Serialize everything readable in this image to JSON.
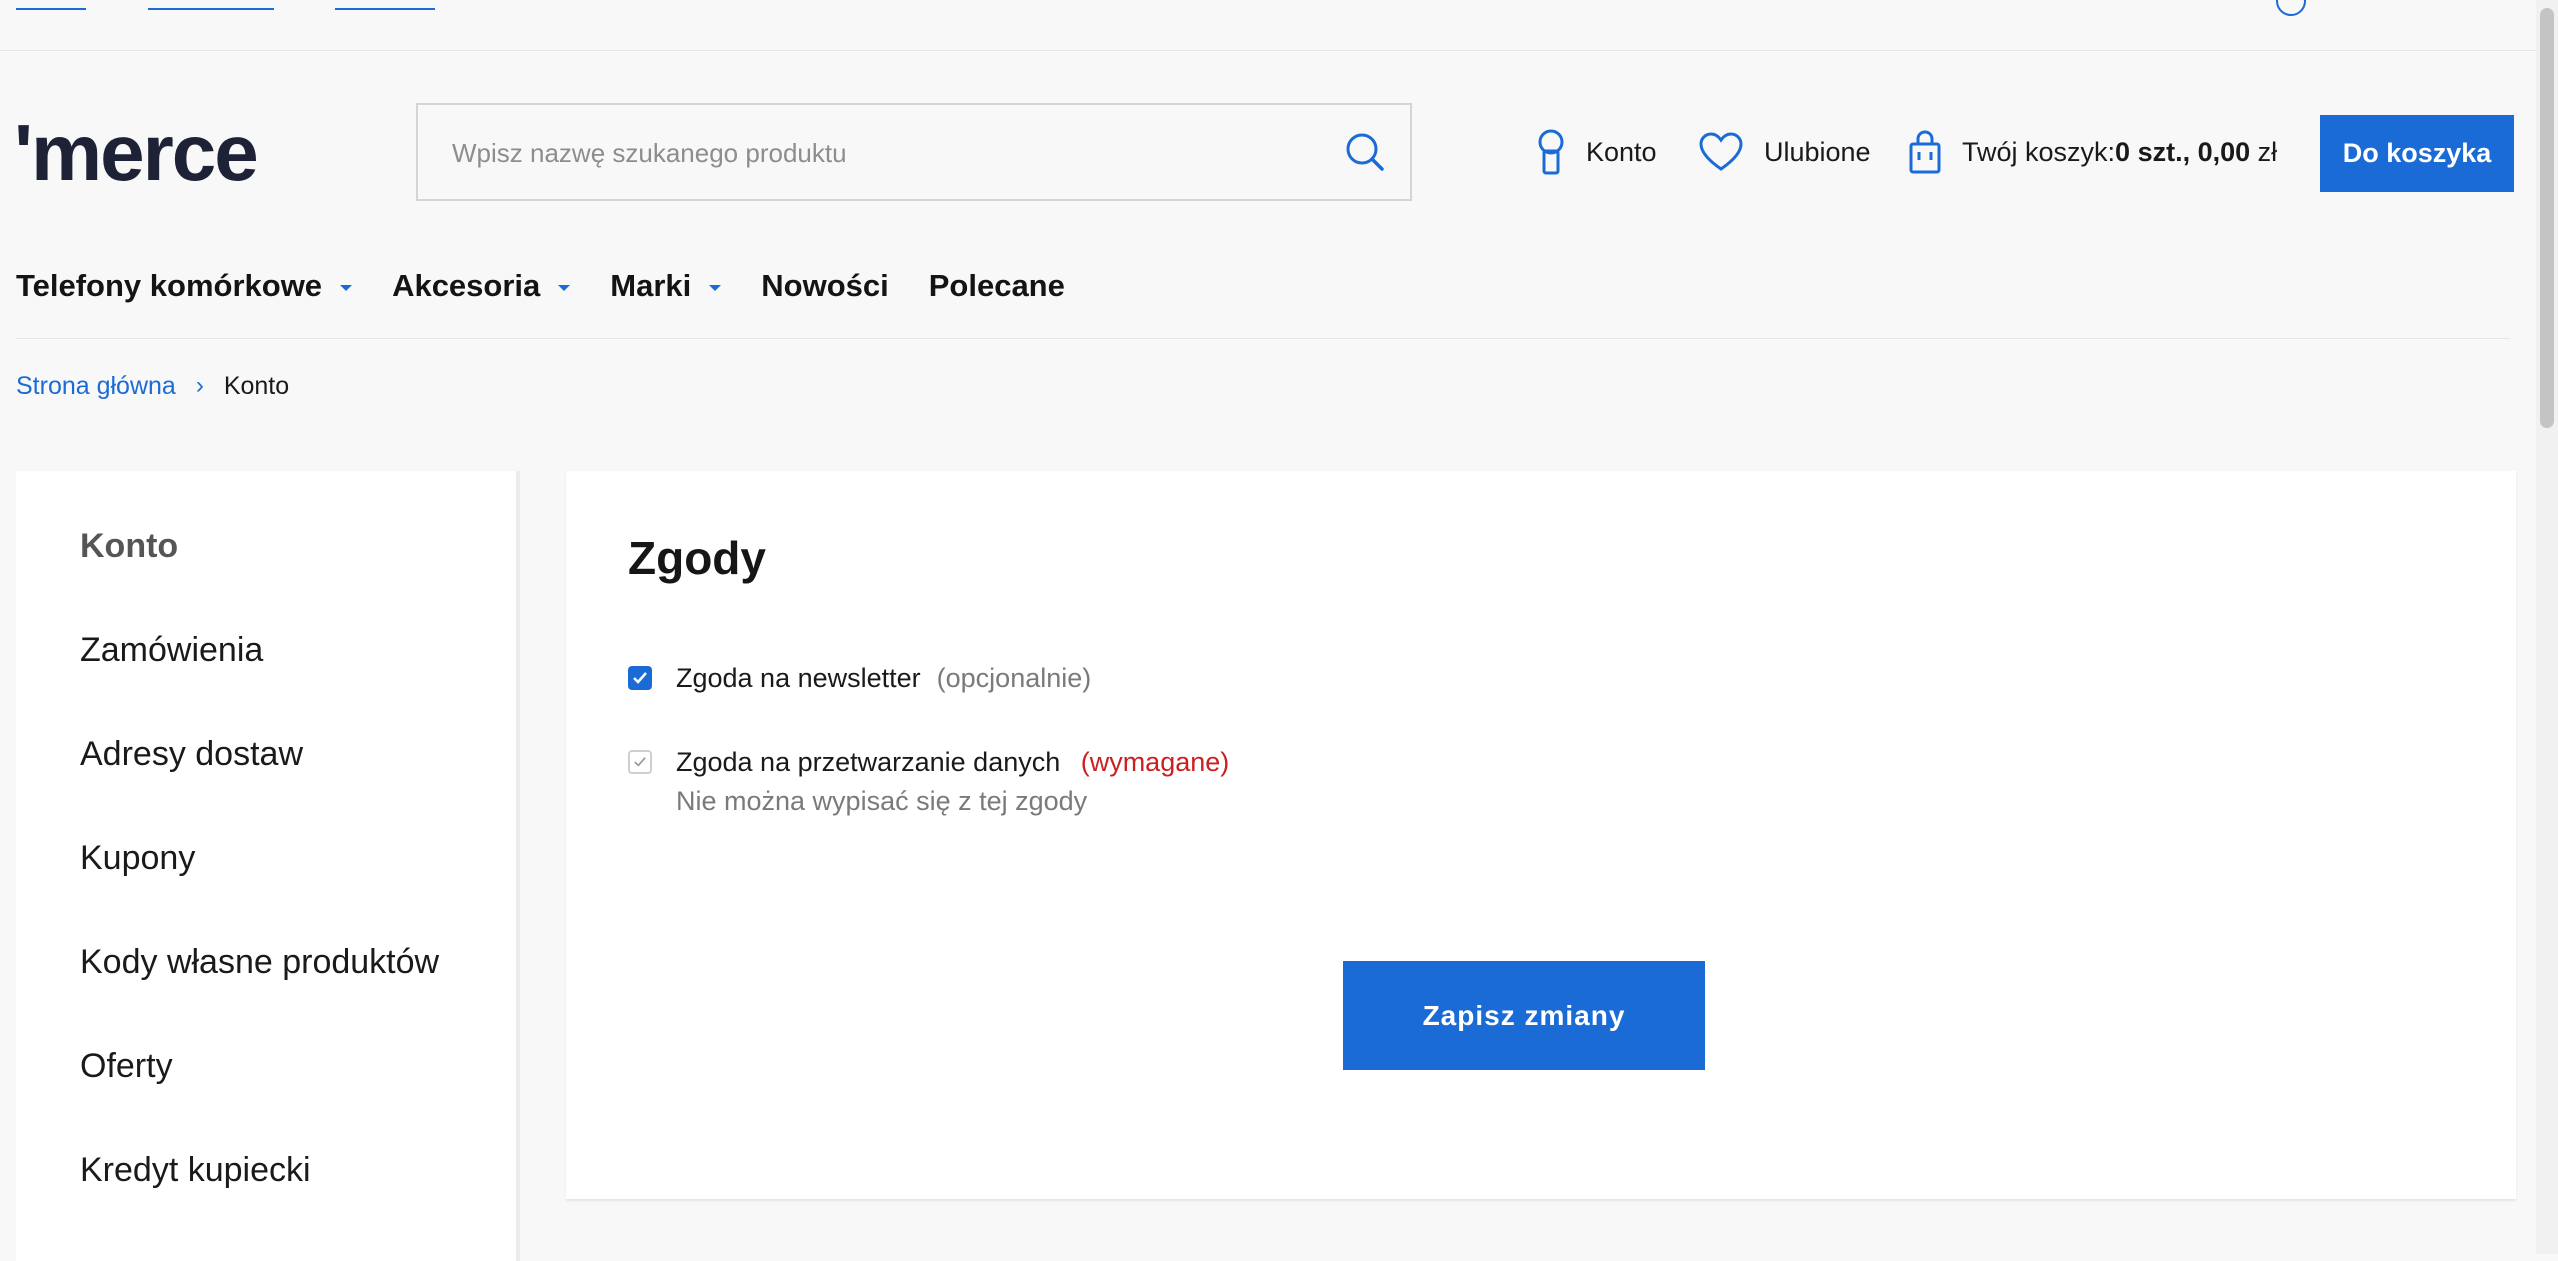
{
  "colors": {
    "accent": "#1a6bd6",
    "required": "#cc1f1f",
    "muted": "#7a7a7a"
  },
  "brand": {
    "logo": "'merce"
  },
  "search": {
    "placeholder": "Wpisz nazwę szukanego produktu",
    "icon": "search-icon"
  },
  "header": {
    "account_label": "Konto",
    "favorites_label": "Ulubione",
    "cart_prefix": "Twój koszyk:",
    "cart_count": "0 szt.,",
    "cart_total": "0,00",
    "cart_currency": "zł",
    "cart_button": "Do koszyka"
  },
  "nav": {
    "items": [
      {
        "label": "Telefony komórkowe",
        "dropdown": true
      },
      {
        "label": "Akcesoria",
        "dropdown": true
      },
      {
        "label": "Marki",
        "dropdown": true
      },
      {
        "label": "Nowości",
        "dropdown": false
      },
      {
        "label": "Polecane",
        "dropdown": false
      }
    ]
  },
  "breadcrumb": {
    "home": "Strona główna",
    "separator": "›",
    "current": "Konto"
  },
  "sidebar": {
    "items": [
      {
        "label": "Konto",
        "active": true
      },
      {
        "label": "Zamówienia",
        "active": false
      },
      {
        "label": "Adresy dostaw",
        "active": false
      },
      {
        "label": "Kupony",
        "active": false
      },
      {
        "label": "Kody własne produktów",
        "active": false
      },
      {
        "label": "Oferty",
        "active": false
      },
      {
        "label": "Kredyt kupiecki",
        "active": false
      }
    ]
  },
  "consents": {
    "title": "Zgody",
    "newsletter": {
      "label": "Zgoda na newsletter",
      "tag": "(opcjonalnie)",
      "checked": true
    },
    "data_processing": {
      "label": "Zgoda na przetwarzanie danych",
      "tag": "(wymagane)",
      "note": "Nie można wypisać się z tej zgody",
      "checked": true,
      "disabled": true
    },
    "save_button": "Zapisz zmiany"
  }
}
